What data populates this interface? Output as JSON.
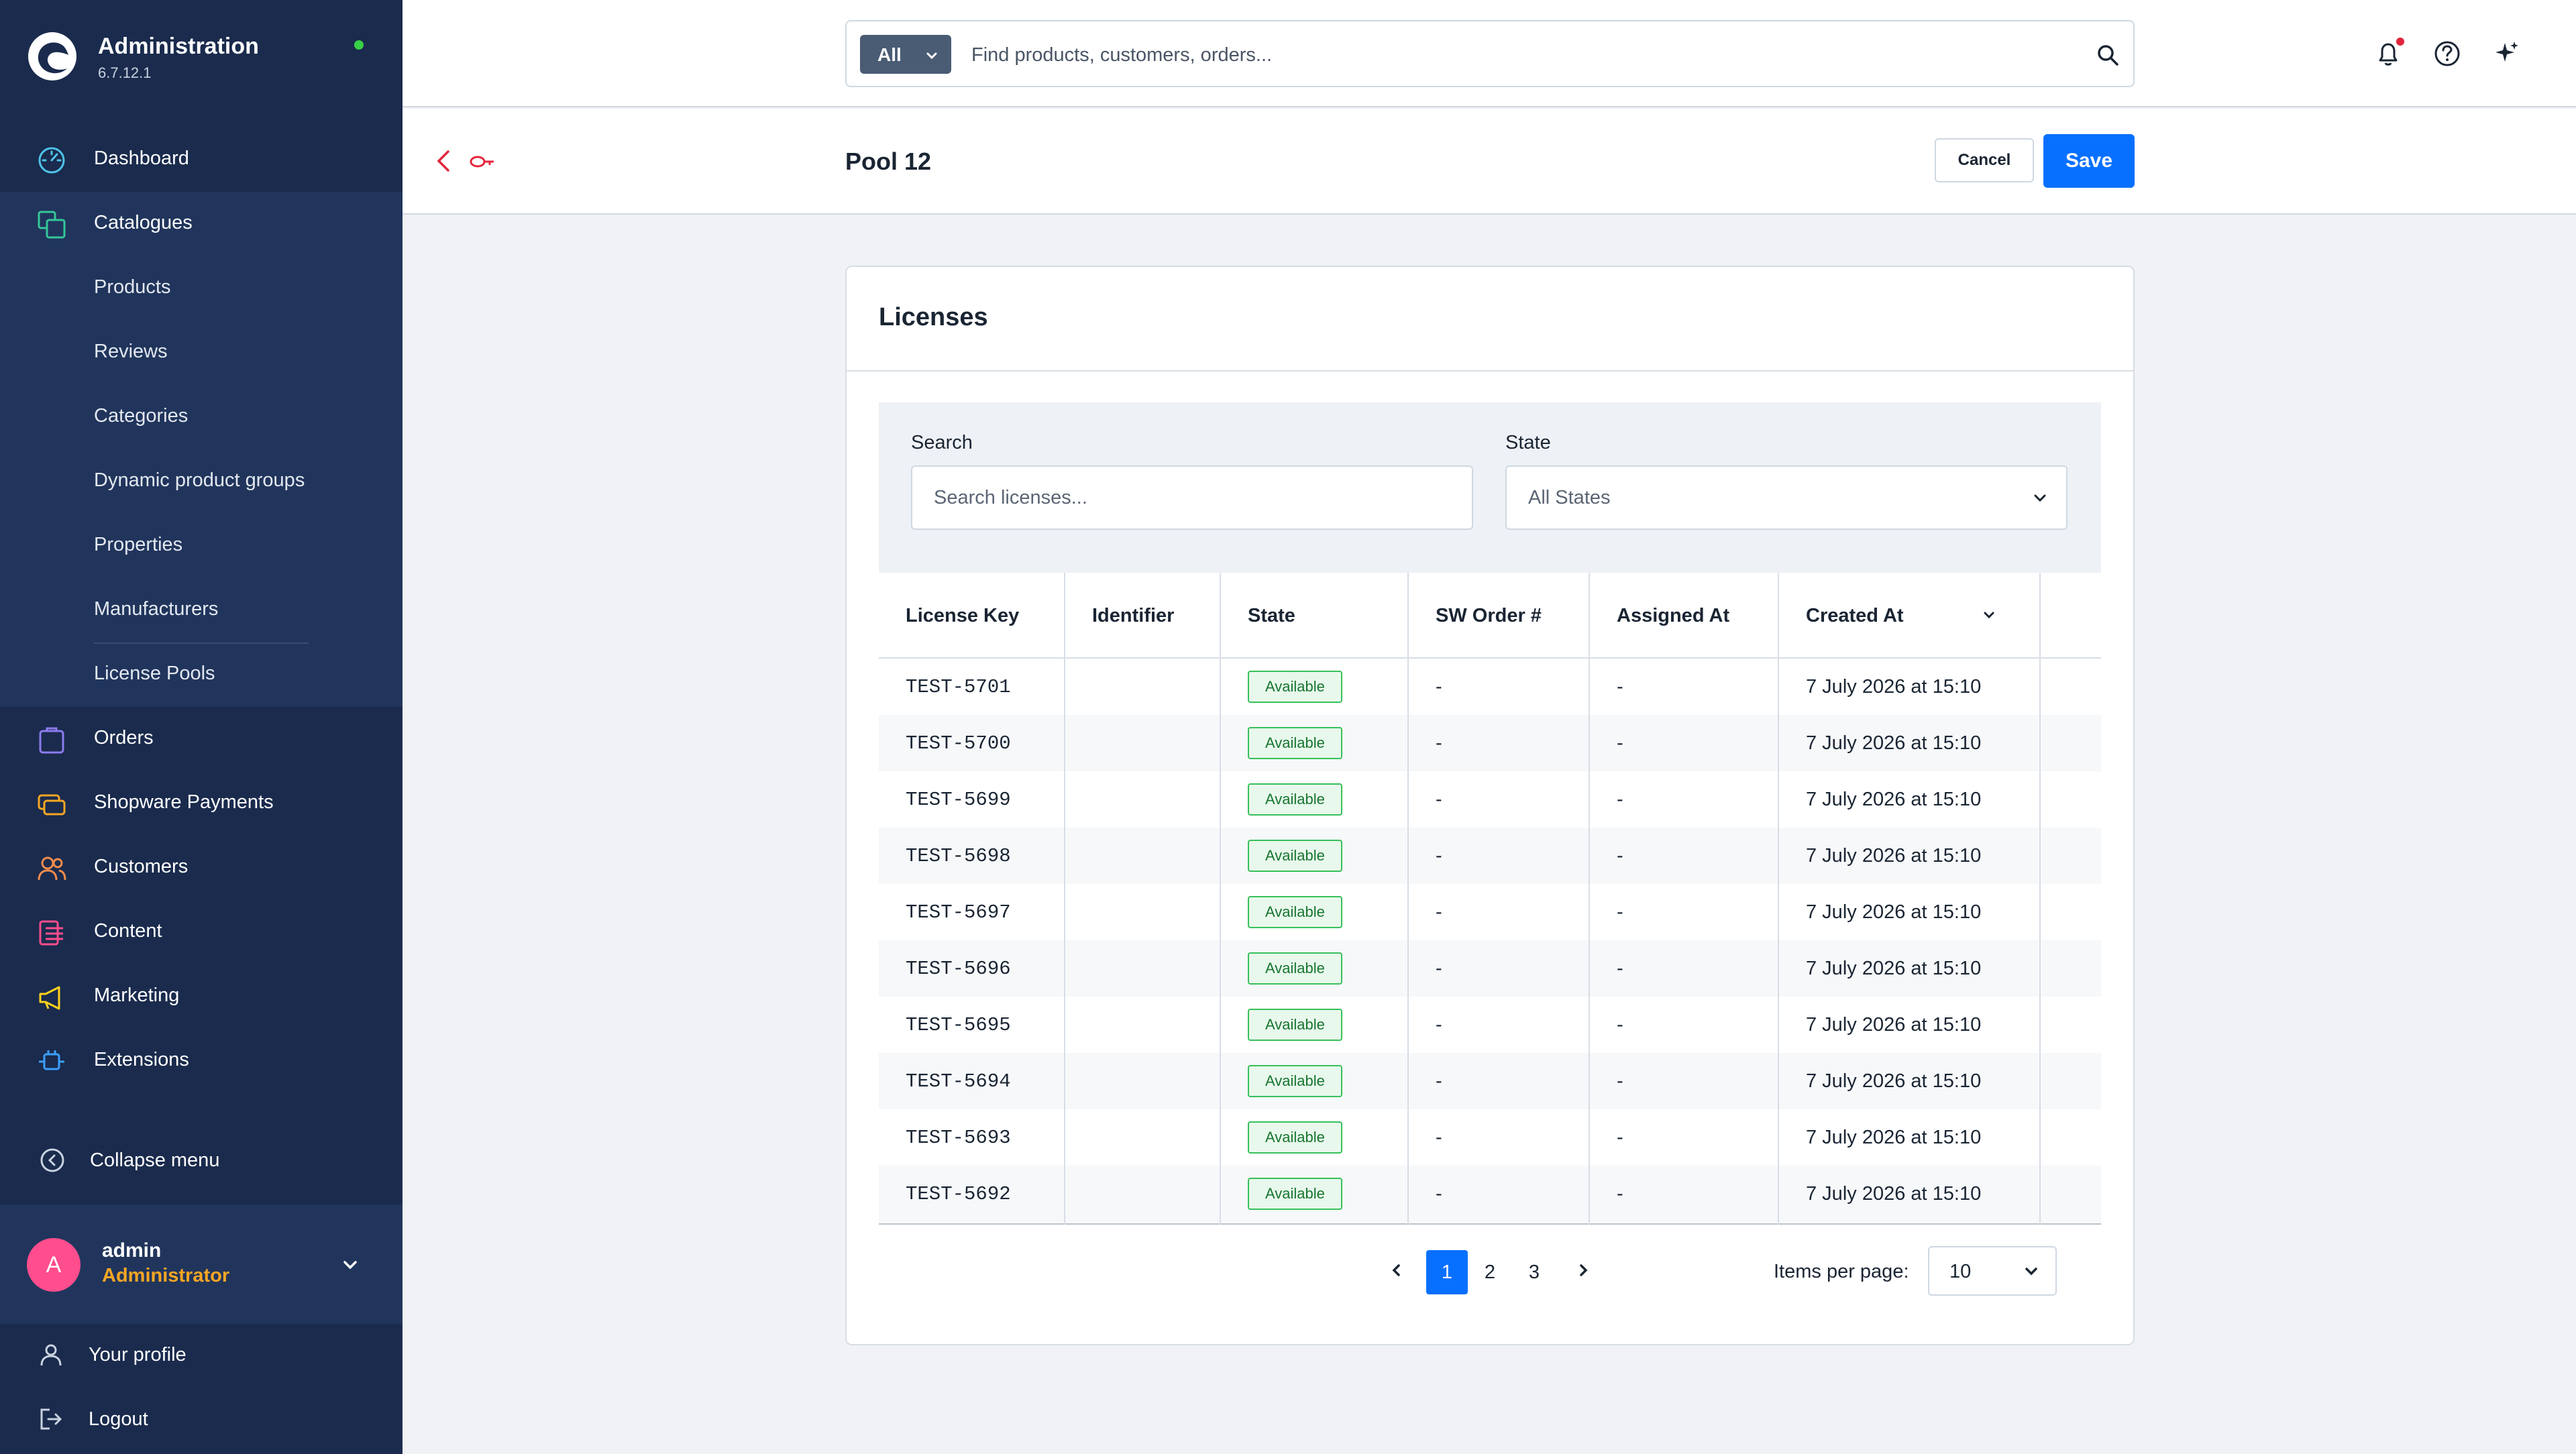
{
  "app": {
    "title": "Administration",
    "version": "6.7.12.1"
  },
  "sidebar": {
    "items": [
      {
        "label": "Dashboard",
        "icon": "dashboard-icon"
      },
      {
        "label": "Catalogues",
        "icon": "catalogues-icon"
      },
      {
        "label": "Orders",
        "icon": "orders-icon"
      },
      {
        "label": "Shopware Payments",
        "icon": "payments-icon"
      },
      {
        "label": "Customers",
        "icon": "customers-icon"
      },
      {
        "label": "Content",
        "icon": "content-icon"
      },
      {
        "label": "Marketing",
        "icon": "marketing-icon"
      },
      {
        "label": "Extensions",
        "icon": "extensions-icon"
      }
    ],
    "catalogue_children": [
      "Products",
      "Reviews",
      "Categories",
      "Dynamic product groups",
      "Properties",
      "Manufacturers",
      "License Pools"
    ],
    "collapse_label": "Collapse menu",
    "user": {
      "initial": "A",
      "name": "admin",
      "role": "Administrator"
    },
    "profile_label": "Your profile",
    "logout_label": "Logout",
    "colors": {
      "background": "#1a2b4d",
      "active": "#21355c",
      "dashboard": "#4fc3e8",
      "catalogues": "#34c79a",
      "orders": "#8c7bf0",
      "payments": "#f6a623",
      "customers": "#f28c4c",
      "content": "#ff4d8d",
      "marketing": "#ffd21f",
      "extensions": "#3ba0ff"
    }
  },
  "search": {
    "scope": "All",
    "placeholder": "Find products, customers, orders..."
  },
  "page": {
    "title": "Pool 12",
    "cancel_label": "Cancel",
    "save_label": "Save"
  },
  "licenses": {
    "title": "Licenses",
    "search_label": "Search",
    "search_placeholder": "Search licenses...",
    "state_label": "State",
    "state_value": "All States",
    "columns": [
      "License Key",
      "Identifier",
      "State",
      "SW Order #",
      "Assigned At",
      "Created At"
    ],
    "rows": [
      {
        "key": "TEST-5701",
        "identifier": "",
        "state": "Available",
        "order": "-",
        "assigned": "-",
        "created": "7 July 2026 at 15:10"
      },
      {
        "key": "TEST-5700",
        "identifier": "",
        "state": "Available",
        "order": "-",
        "assigned": "-",
        "created": "7 July 2026 at 15:10"
      },
      {
        "key": "TEST-5699",
        "identifier": "",
        "state": "Available",
        "order": "-",
        "assigned": "-",
        "created": "7 July 2026 at 15:10"
      },
      {
        "key": "TEST-5698",
        "identifier": "",
        "state": "Available",
        "order": "-",
        "assigned": "-",
        "created": "7 July 2026 at 15:10"
      },
      {
        "key": "TEST-5697",
        "identifier": "",
        "state": "Available",
        "order": "-",
        "assigned": "-",
        "created": "7 July 2026 at 15:10"
      },
      {
        "key": "TEST-5696",
        "identifier": "",
        "state": "Available",
        "order": "-",
        "assigned": "-",
        "created": "7 July 2026 at 15:10"
      },
      {
        "key": "TEST-5695",
        "identifier": "",
        "state": "Available",
        "order": "-",
        "assigned": "-",
        "created": "7 July 2026 at 15:10"
      },
      {
        "key": "TEST-5694",
        "identifier": "",
        "state": "Available",
        "order": "-",
        "assigned": "-",
        "created": "7 July 2026 at 15:10"
      },
      {
        "key": "TEST-5693",
        "identifier": "",
        "state": "Available",
        "order": "-",
        "assigned": "-",
        "created": "7 July 2026 at 15:10"
      },
      {
        "key": "TEST-5692",
        "identifier": "",
        "state": "Available",
        "order": "-",
        "assigned": "-",
        "created": "7 July 2026 at 15:10"
      }
    ],
    "pagination": {
      "pages": [
        "1",
        "2",
        "3"
      ],
      "current": "1",
      "items_per_page_label": "Items per page:",
      "items_per_page": "10"
    }
  },
  "colors": {
    "primary": "#0870ff",
    "available_border": "#37c05a",
    "available_text": "#16752f",
    "back_link": "#e3253c"
  }
}
